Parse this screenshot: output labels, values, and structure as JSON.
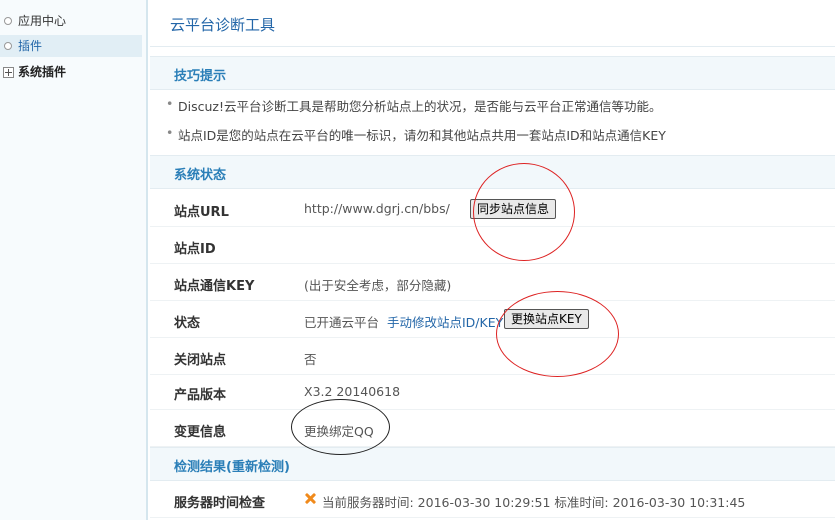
{
  "sidebar": {
    "items": [
      {
        "label": "应用中心"
      },
      {
        "label": "插件"
      },
      {
        "label": "系统插件"
      }
    ]
  },
  "page": {
    "title": "云平台诊断工具"
  },
  "tips": {
    "heading": "技巧提示",
    "items": [
      "Discuz!云平台诊断工具是帮助您分析站点上的状况，是否能与云平台正常通信等功能。",
      "站点ID是您的站点在云平台的唯一标识，请勿和其他站点共用一套站点ID和站点通信KEY"
    ]
  },
  "status": {
    "heading": "系统状态",
    "site_url_label": "站点URL",
    "site_url_value": "http://www.dgrj.cn/bbs/",
    "sync_button": "同步站点信息",
    "site_id_label": "站点ID",
    "site_key_label": "站点通信KEY",
    "site_key_value": "(出于安全考虑，部分隐藏)",
    "state_label": "状态",
    "state_value": "已开通云平台",
    "state_link": "手动修改站点ID/KEY",
    "change_key_button": "更换站点KEY",
    "close_site_label": "关闭站点",
    "close_site_value": "否",
    "version_label": "产品版本",
    "version_value": "X3.2 20140618",
    "change_info_label": "变更信息",
    "change_info_link": "更换绑定QQ"
  },
  "results": {
    "heading": "检测结果(重新检测)",
    "server_time_label": "服务器时间检查",
    "server_time_value": "当前服务器时间: 2016-03-30 10:29:51 标准时间: 2016-03-30 10:31:45"
  }
}
